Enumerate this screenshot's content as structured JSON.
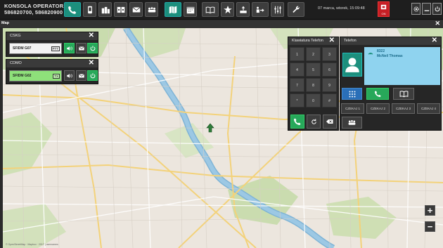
{
  "header": {
    "title_line1": "KONSOLA OPERATORA",
    "title_line2": "586820700, 586820900",
    "datetime": "07 marca, wtorek, 15:09:48",
    "alarm_label": "ON"
  },
  "toolbar": {
    "icons": [
      "phone-icon",
      "mobile-icon",
      "radio-group-icon",
      "intercom-icon",
      "mail-icon",
      "group-icon",
      "map-icon",
      "calendar-icon",
      "book-icon",
      "star-icon",
      "upload-icon",
      "transfer-icon",
      "equalizer-icon",
      "wrench-icon"
    ]
  },
  "map_tab": {
    "label": "Map"
  },
  "panel_cskg": {
    "title": "CSKG",
    "radio": {
      "name": "SFIDM G07",
      "tag": "PTT"
    }
  },
  "panel_cdmo": {
    "title": "CDMO",
    "radio": {
      "name": "SFIDM G02",
      "tag": "TX"
    }
  },
  "keypad": {
    "title": "Klawiatura Telefon",
    "keys": [
      "1",
      "2",
      "3",
      "4",
      "5",
      "6",
      "7",
      "8",
      "9",
      "*",
      "0",
      "#"
    ]
  },
  "phone": {
    "title": "Telefon",
    "caller_number": "8322",
    "caller_name": "McNeil Thomas",
    "wait_buttons": [
      "CZEKAJ 1",
      "CZEKAJ 2",
      "CZEKAJ 3",
      "CZEKAJ 4"
    ]
  },
  "map": {
    "attribution": "© OpenStreetMap · Mapbox · 2017 | osmnames",
    "zoom_in": "+",
    "zoom_out": "−"
  },
  "colors": {
    "accent": "#27a85a",
    "teal": "#1c8f7d",
    "alarm": "#c61f25",
    "caller_bg": "#8fd3ef"
  }
}
